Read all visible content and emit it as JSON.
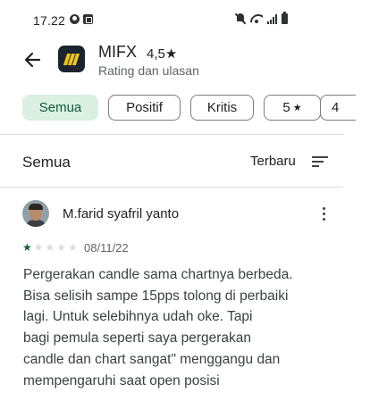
{
  "status_bar": {
    "time": "17.22",
    "left_icons": [
      "whatsapp-icon",
      "gallery-icon"
    ],
    "right_icons": [
      "mute-icon",
      "wifi-icon",
      "signal-icon",
      "battery-icon"
    ]
  },
  "header": {
    "back_icon": "arrow-left-icon",
    "app_icon": "mifx-app-icon",
    "app_name": "MIFX",
    "rating": "4,5★",
    "subtitle": "Rating dan ulasan"
  },
  "filters": {
    "chips": [
      {
        "label": "Semua",
        "active": true
      },
      {
        "label": "Positif",
        "active": false
      },
      {
        "label": "Kritis",
        "active": false
      },
      {
        "label": "5",
        "star": "★",
        "active": false
      },
      {
        "label": "4",
        "active": false
      }
    ]
  },
  "section": {
    "title": "Semua",
    "sort_label": "Terbaru",
    "sort_icon": "sort-icon"
  },
  "review": {
    "author": "M.farid syafril yanto",
    "rating": 1,
    "max_rating": 5,
    "date": "08/11/22",
    "more_icon": "more-vert-icon",
    "lines": [
      "Pergerakan candle sama chartnya berbeda.",
      "Bisa selisih sampe 15pps tolong di perbaiki",
      "lagi. Untuk selebihnya udah oke. Tapi",
      "bagi pemula seperti saya pergerakan",
      "candle dan chart sangat\" menggangu dan",
      "mempengaruhi saat open posisi"
    ]
  },
  "colors": {
    "accent_green": "#0d5c39",
    "chip_active_bg": "#dbefe3",
    "star_filled": "#0d652d",
    "star_empty": "#dadce0"
  }
}
